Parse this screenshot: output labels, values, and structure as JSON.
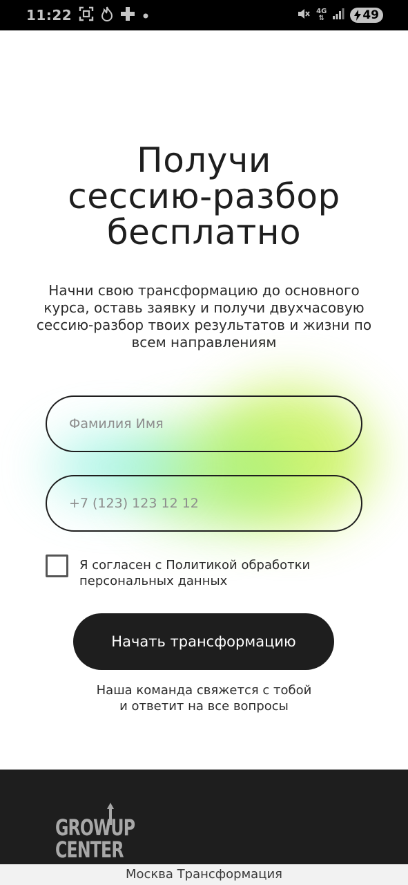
{
  "status_bar": {
    "time": "11:22",
    "network": "4G",
    "battery": "49",
    "icons": [
      "screenshot-icon",
      "flame-icon",
      "plus-icon",
      "dot-icon",
      "mute-icon",
      "signal-icon",
      "charging-icon"
    ]
  },
  "hero": {
    "title_lines": [
      "Получи",
      "сессию-разбор",
      "бесплатно"
    ],
    "subtitle": "Начни свою трансформацию до основного курса, оставь заявку и получи двухчасовую сессию-разбор твоих результатов и жизни по всем направлениям"
  },
  "form": {
    "name_placeholder": "Фамилия Имя",
    "phone_placeholder": "+7 (123) 123 12 12",
    "consent_text": "Я согласен с Политикой обработки персональных данных",
    "submit_label": "Начать трансформацию",
    "note_lines": [
      "Наша команда свяжется с тобой",
      "и ответит на все вопросы"
    ]
  },
  "footer": {
    "logo_lines": [
      "GROWUP",
      "CENTER"
    ]
  },
  "url_bar": {
    "text": "Москва Трансформация"
  },
  "colors": {
    "dark": "#1e1e1e",
    "glow_green": "#c9f25a",
    "glow_cyan": "#86f0dc",
    "logo_gray": "#a8a8a8"
  }
}
